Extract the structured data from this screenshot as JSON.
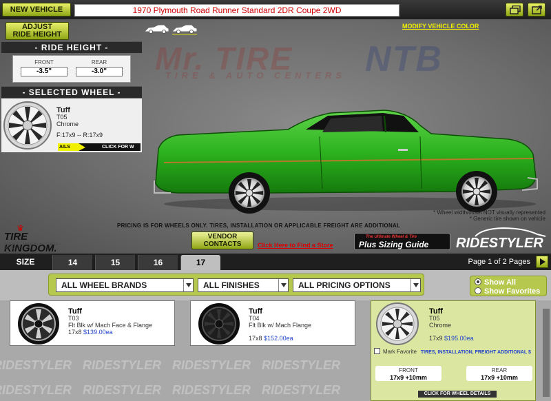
{
  "topbar": {
    "new_vehicle_label": "NEW VEHICLE",
    "vehicle_title": "1970 Plymouth Road Runner Standard 2DR Coupe  2WD",
    "expand_icon": "restore-window-icon",
    "popout_icon": "popout-icon"
  },
  "stage": {
    "adjust_label": "ADJUST\nRIDE HEIGHT",
    "modify_color_label": "MODIFY VEHICLE COLOR",
    "watermark_brand": "Mr. TIRE",
    "watermark_sub": "TIRE & AUTO CENTERS",
    "watermark_brand2": "NTB",
    "car_color": "#2db31f"
  },
  "ride_height": {
    "title": "- RIDE HEIGHT -",
    "front_label": "FRONT",
    "front_value": "-3.5\"",
    "rear_label": "REAR",
    "rear_value": "-3.0\""
  },
  "selected_wheel": {
    "title": "- SELECTED WHEEL -",
    "brand": "Tuff",
    "model": "T05",
    "finish": "Chrome",
    "sizes": "F:17x9 -- R:17x9",
    "ticker_left": "AILS",
    "ticker_right": "CLICK FOR W"
  },
  "notes": {
    "line1": "* Wheel width/offset NOT visually represented",
    "line2": "* Generic tire shown on vehicle"
  },
  "pricing_note": "PRICING IS FOR WHEELS ONLY. TIRES, INSTALLATION OR APPLICABLE FREIGHT ARE ADDITIONAL",
  "vendor_contacts_label": "VENDOR\nCONTACTS",
  "find_store_label": "Click Here to Find a Store",
  "tire_kingdom": {
    "name": "TIRE KINGDOM.",
    "tagline": "SERVICE • BRAKES • BATTERIES • MORE"
  },
  "plus_guide": {
    "top": "The Ultimate Wheel & Tire",
    "main": "Plus Sizing Guide"
  },
  "ridestyler_logo": "RIDESTYLER",
  "sizes": {
    "label": "SIZE",
    "tabs": [
      "14",
      "15",
      "16",
      "17"
    ],
    "active": "17",
    "page_info": "Page 1 of 2 Pages"
  },
  "filters": {
    "brands": "ALL WHEEL BRANDS",
    "finishes": "ALL FINISHES",
    "pricing": "ALL PRICING OPTIONS",
    "show_all": "Show All",
    "show_favorites": "Show Favorites"
  },
  "wheels": [
    {
      "brand": "Tuff",
      "model": "T03",
      "finish": "Flt Blk w/ Mach Face & Flange",
      "size": "17x8",
      "price": "$139.00ea"
    },
    {
      "brand": "Tuff",
      "model": "T04",
      "finish": "Flt Blk w/ Mach Flange",
      "size": "17x8",
      "price": "$152.00ea"
    },
    {
      "brand": "Tuff",
      "model": "T05",
      "finish": "Chrome",
      "size": "17x9",
      "price": "$195.00ea"
    }
  ],
  "selected_card": {
    "mark_favorite": "Mark Favorite",
    "ticker": "TIRES, INSTALLATION, FREIGHT ADDITIONAL $",
    "front_label": "FRONT",
    "front_fit": "17x9 +10mm",
    "rear_label": "REAR",
    "rear_fit": "17x9 +10mm",
    "details_label": "CLICK FOR WHEEL DETAILS"
  },
  "grid_watermark": "RIDESTYLER"
}
